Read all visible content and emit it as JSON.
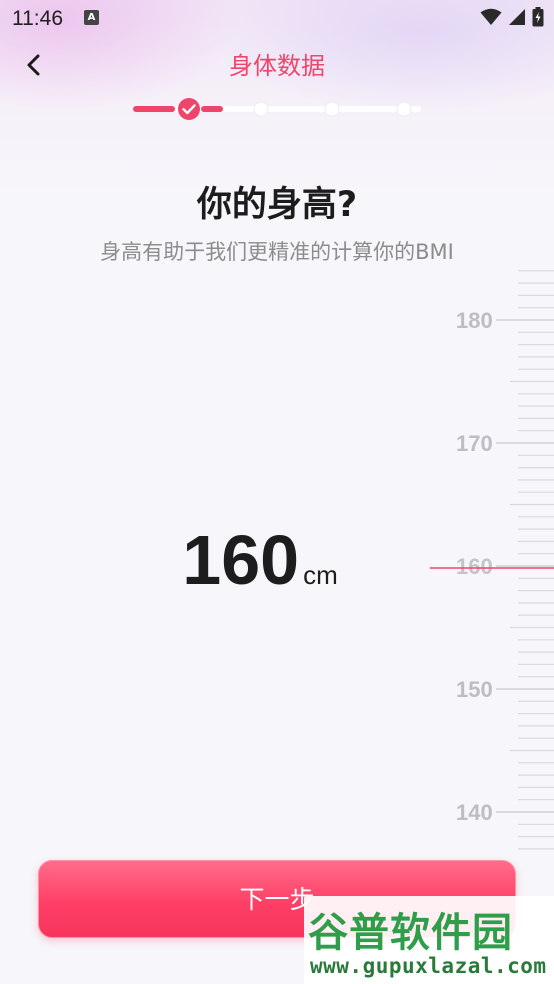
{
  "status_bar": {
    "time": "11:46",
    "notification_icon_letter": "A"
  },
  "header": {
    "title": "身体数据"
  },
  "stepper": {
    "current_step": 1,
    "total_steps": 5,
    "accent_color": "#f0456b"
  },
  "question": {
    "title": "你的身高?",
    "subtitle": "身高有助于我们更精准的计算你的BMI"
  },
  "value": {
    "number": "160",
    "unit": "cm"
  },
  "ruler": {
    "labels": [
      "180",
      "170",
      "160",
      "150",
      "140"
    ],
    "selected": "160",
    "indicator_color": "#f0456b"
  },
  "next_button": {
    "label": "下一步"
  },
  "watermark": {
    "title": "谷普软件园",
    "url": "www.gupuxlazal.com"
  }
}
